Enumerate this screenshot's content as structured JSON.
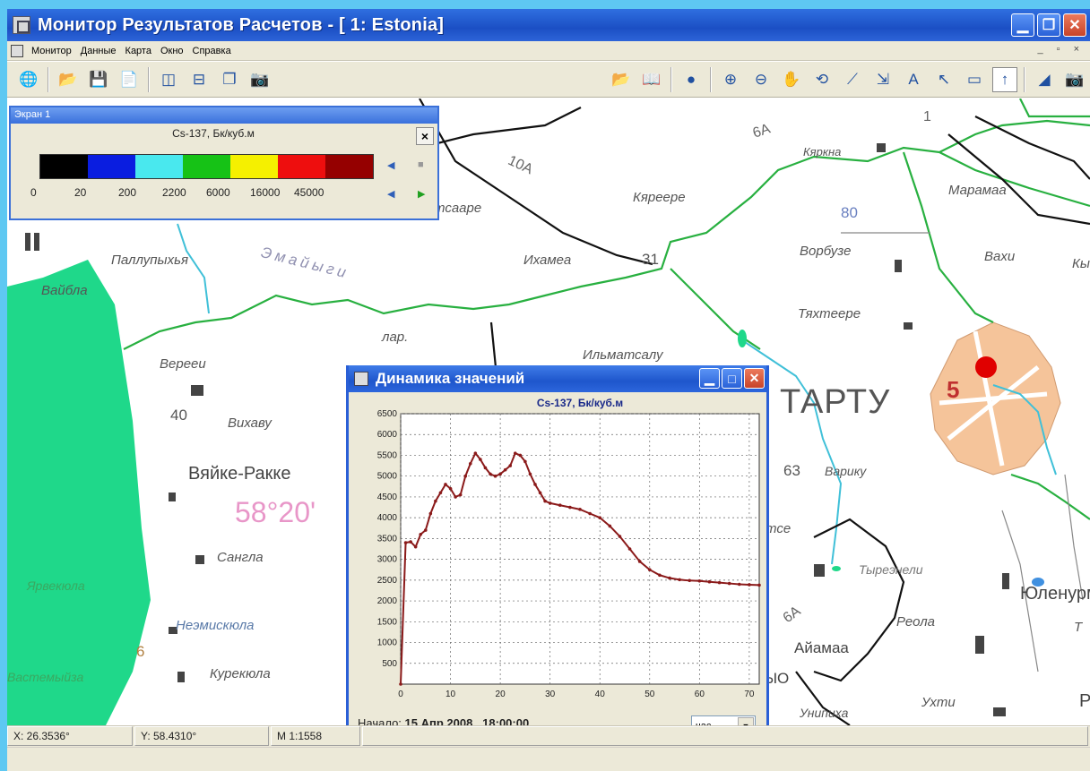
{
  "window": {
    "title": "Монитор Результатов Расчетов - [ 1: Estonia]"
  },
  "menu": [
    "Монитор",
    "Данные",
    "Карта",
    "Окно",
    "Справка"
  ],
  "screen_panel": {
    "title": "Экран 1",
    "legend_caption": "Cs-137, Бк/куб.м",
    "swatch_colors": [
      "#000000",
      "#0a1de0",
      "#49e8ee",
      "#16c216",
      "#f5f000",
      "#ee0e0e",
      "#950000"
    ],
    "thresholds": [
      "0",
      "20",
      "200",
      "2200",
      "6000",
      "16000",
      "45000"
    ],
    "close_label": "×"
  },
  "map_labels": {
    "paluphya": "Паллупыхья",
    "vaibla": "Вайбла",
    "emajogi": "Эмайыги",
    "tsaare": "тсааре",
    "ihamea": "Ихамеа",
    "kyareere": "Кяреере",
    "kyarkna": "Кяркна",
    "maramaa": "Марамаа",
    "vorbuze": "Ворбузе",
    "vaxi": "Вахи",
    "tyahteere": "Тяхтеере",
    "lap": "лар.",
    "ilmatsalu": "Ильматсалу",
    "verevi": "Верееи",
    "vihavu": "Вихаву",
    "vyaike_rakke": "Вяйке-Ракке",
    "lat": "58°20'",
    "sangla": "Сангла",
    "yarvekyula": "Ярвекюла",
    "neemiskyula": "Неэмискюла",
    "kurekyula": "Курекюла",
    "vastemõisa": "Вастемыйза",
    "tartu": "ТАРТУ",
    "variku": "Варику",
    "ts": "тсе",
    "tyreneli": "Тыреэнели",
    "reola": "Реола",
    "ajamaa": "Айамаа",
    "lo": "ЫО",
    "unipiha": "Унипиха",
    "uhti": "Ухти",
    "yulenurme": "Юленурме",
    "kyi": "Кы",
    "t_right": "Т",
    "r_right": "Р",
    "road_10a": "10А",
    "road_6a_top": "6А",
    "road_6a_bottom": "6А",
    "road_1": "1",
    "num_31": "31",
    "num_80": "80",
    "num_40": "40",
    "num_63": "63",
    "num_6": "6",
    "num_5": "5"
  },
  "dynamics_window": {
    "title": "Динамика значений",
    "start_label": "Начало:",
    "start_value": "15 Апр 2008 , 18:00:00",
    "unit": "час."
  },
  "chart_data": {
    "type": "line",
    "title": "Cs-137, Бк/куб.м",
    "xlabel": "",
    "ylabel": "",
    "xlim": [
      0,
      72
    ],
    "ylim": [
      0,
      6500
    ],
    "x_ticks": [
      0,
      10,
      20,
      30,
      40,
      50,
      60,
      70
    ],
    "y_ticks": [
      500,
      1000,
      1500,
      2000,
      2500,
      3000,
      3500,
      4000,
      4500,
      5000,
      5500,
      6000,
      6500
    ],
    "grid": true,
    "line_color": "#8b1a1a",
    "x": [
      0,
      1,
      2,
      3,
      4,
      5,
      6,
      7,
      8,
      9,
      10,
      11,
      12,
      13,
      14,
      15,
      16,
      17,
      18,
      19,
      20,
      21,
      22,
      23,
      24,
      25,
      26,
      27,
      28,
      29,
      30,
      32,
      34,
      36,
      38,
      40,
      42,
      44,
      46,
      48,
      50,
      52,
      54,
      56,
      58,
      60,
      62,
      64,
      66,
      68,
      70,
      72
    ],
    "y": [
      0,
      3400,
      3420,
      3300,
      3600,
      3700,
      4100,
      4400,
      4600,
      4800,
      4700,
      4500,
      4550,
      5000,
      5300,
      5550,
      5400,
      5200,
      5050,
      5000,
      5050,
      5150,
      5250,
      5550,
      5500,
      5350,
      5050,
      4800,
      4600,
      4400,
      4350,
      4300,
      4250,
      4200,
      4100,
      4000,
      3800,
      3550,
      3250,
      2950,
      2750,
      2620,
      2550,
      2510,
      2490,
      2480,
      2460,
      2440,
      2420,
      2400,
      2390,
      2380
    ]
  },
  "statusbar": {
    "x": "X: 26.3536°",
    "y": "Y: 58.4310°",
    "scale": "M 1:1558"
  }
}
